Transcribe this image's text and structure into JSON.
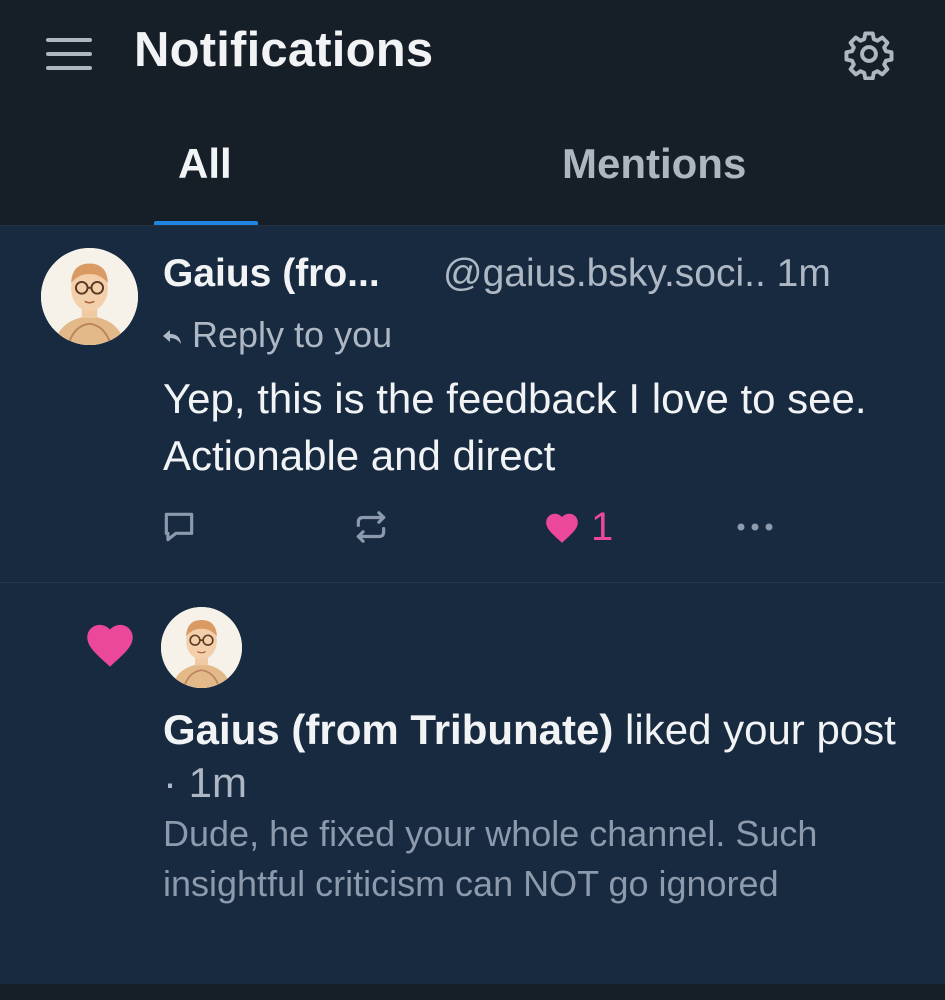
{
  "header": {
    "title": "Notifications",
    "tabs": [
      {
        "label": "All",
        "active": true
      },
      {
        "label": "Mentions",
        "active": false
      }
    ]
  },
  "notifications": [
    {
      "type": "reply",
      "author": "Gaius (fro...",
      "handle": "@gaius.bsky.soci..",
      "time": "1m",
      "context": "Reply to you",
      "text": "Yep, this is the feedback I love to see. Actionable and direct",
      "like_count": "1",
      "liked": true
    },
    {
      "type": "like",
      "author": "Gaius (from Tribunate)",
      "action": " liked your post",
      "time": " · 1m",
      "quoted_text": "Dude, he fixed your whole channel. Such insightful criticism can NOT go ignored"
    }
  ],
  "colors": {
    "accent": "#1f85e3",
    "like": "#ec4899",
    "background": "#161e27",
    "card": "#172a40"
  }
}
